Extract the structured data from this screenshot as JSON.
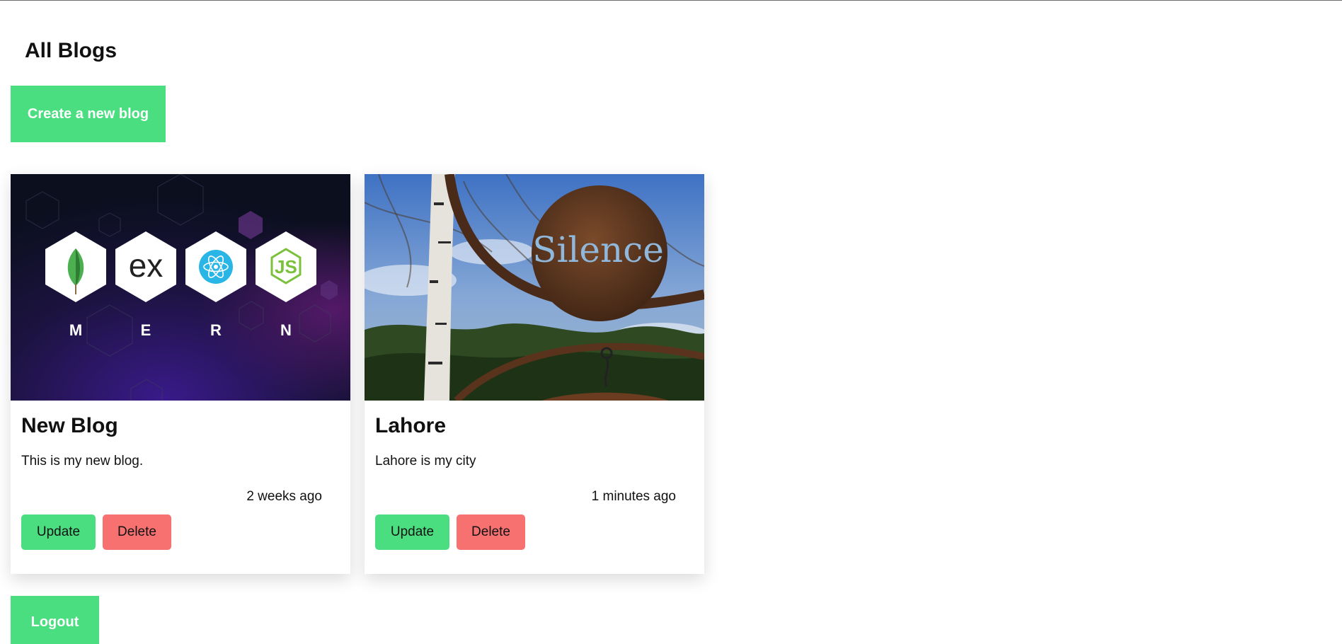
{
  "page": {
    "title": "All Blogs",
    "create_label": "Create a new blog",
    "logout_label": "Logout"
  },
  "colors": {
    "primary_green": "#4ade80",
    "delete_red": "#f87171"
  },
  "blogs": [
    {
      "title": "New Blog",
      "description": "This is my new blog.",
      "time": "2 weeks ago",
      "update_label": "Update",
      "delete_label": "Delete",
      "image": {
        "kind": "mern-stack-banner",
        "letters": [
          "M",
          "E",
          "R",
          "N"
        ]
      }
    },
    {
      "title": "Lahore",
      "description": "Lahore is my city",
      "time": "1 minutes ago",
      "update_label": "Update",
      "delete_label": "Delete",
      "image": {
        "kind": "silence-sign-photo",
        "sign_text": "Silence"
      }
    }
  ]
}
